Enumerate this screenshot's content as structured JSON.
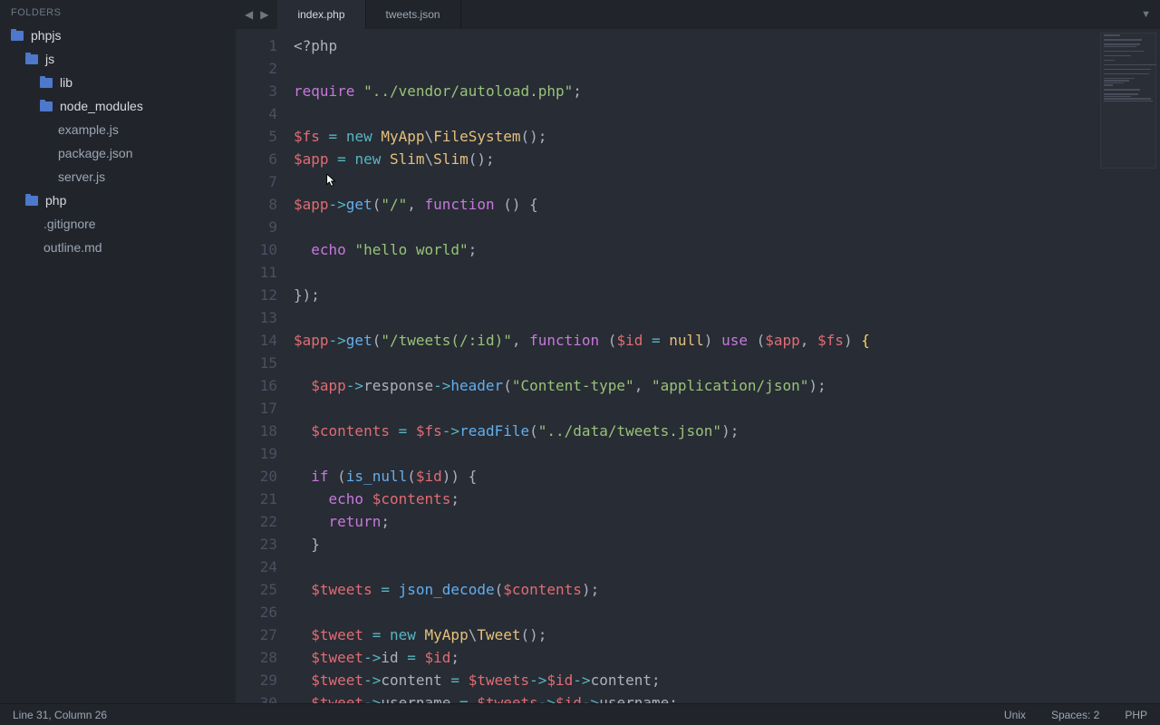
{
  "sidebar": {
    "header": "FOLDERS",
    "tree": [
      {
        "type": "folder",
        "label": "phpjs",
        "depth": 0
      },
      {
        "type": "folder",
        "label": "js",
        "depth": 1
      },
      {
        "type": "folder",
        "label": "lib",
        "depth": 2
      },
      {
        "type": "folder",
        "label": "node_modules",
        "depth": 2
      },
      {
        "type": "file",
        "label": "example.js",
        "depth": 2
      },
      {
        "type": "file",
        "label": "package.json",
        "depth": 2
      },
      {
        "type": "file",
        "label": "server.js",
        "depth": 2
      },
      {
        "type": "folder",
        "label": "php",
        "depth": 1
      },
      {
        "type": "file",
        "label": ".gitignore",
        "depth": 1
      },
      {
        "type": "file",
        "label": "outline.md",
        "depth": 1
      }
    ]
  },
  "tabs": [
    {
      "label": "index.php",
      "active": true
    },
    {
      "label": "tweets.json",
      "active": false
    }
  ],
  "code_lines": [
    [
      {
        "t": "<?php",
        "c": "pn"
      }
    ],
    [],
    [
      {
        "t": "require",
        "c": "kw"
      },
      {
        "t": " ",
        "c": "pn"
      },
      {
        "t": "\"../vendor/autoload.php\"",
        "c": "str"
      },
      {
        "t": ";",
        "c": "pn"
      }
    ],
    [],
    [
      {
        "t": "$fs",
        "c": "var"
      },
      {
        "t": " ",
        "c": "pn"
      },
      {
        "t": "=",
        "c": "op"
      },
      {
        "t": " ",
        "c": "pn"
      },
      {
        "t": "new",
        "c": "op"
      },
      {
        "t": " ",
        "c": "pn"
      },
      {
        "t": "MyApp",
        "c": "cls"
      },
      {
        "t": "\\",
        "c": "pn"
      },
      {
        "t": "FileSystem",
        "c": "cls"
      },
      {
        "t": "();",
        "c": "pn"
      }
    ],
    [
      {
        "t": "$app",
        "c": "var"
      },
      {
        "t": " ",
        "c": "pn"
      },
      {
        "t": "=",
        "c": "op"
      },
      {
        "t": " ",
        "c": "pn"
      },
      {
        "t": "new",
        "c": "op"
      },
      {
        "t": " ",
        "c": "pn"
      },
      {
        "t": "Slim",
        "c": "cls"
      },
      {
        "t": "\\",
        "c": "pn"
      },
      {
        "t": "Slim",
        "c": "cls"
      },
      {
        "t": "();",
        "c": "pn"
      }
    ],
    [],
    [
      {
        "t": "$app",
        "c": "var"
      },
      {
        "t": "->",
        "c": "op"
      },
      {
        "t": "get",
        "c": "fn"
      },
      {
        "t": "(",
        "c": "pn"
      },
      {
        "t": "\"/\"",
        "c": "str"
      },
      {
        "t": ", ",
        "c": "pn"
      },
      {
        "t": "function",
        "c": "kw"
      },
      {
        "t": " () {",
        "c": "pn"
      }
    ],
    [],
    [
      {
        "t": "  ",
        "c": "pn"
      },
      {
        "t": "echo",
        "c": "kw"
      },
      {
        "t": " ",
        "c": "pn"
      },
      {
        "t": "\"hello world\"",
        "c": "str"
      },
      {
        "t": ";",
        "c": "pn"
      }
    ],
    [],
    [
      {
        "t": "});",
        "c": "pn"
      }
    ],
    [],
    [
      {
        "t": "$app",
        "c": "var"
      },
      {
        "t": "->",
        "c": "op"
      },
      {
        "t": "get",
        "c": "fn"
      },
      {
        "t": "(",
        "c": "pn"
      },
      {
        "t": "\"/tweets(/:id)\"",
        "c": "str"
      },
      {
        "t": ", ",
        "c": "pn"
      },
      {
        "t": "function",
        "c": "kw"
      },
      {
        "t": " (",
        "c": "pn"
      },
      {
        "t": "$id",
        "c": "var"
      },
      {
        "t": " ",
        "c": "pn"
      },
      {
        "t": "=",
        "c": "op"
      },
      {
        "t": " ",
        "c": "pn"
      },
      {
        "t": "null",
        "c": "cls"
      },
      {
        "t": ") ",
        "c": "pn"
      },
      {
        "t": "use",
        "c": "kw"
      },
      {
        "t": " (",
        "c": "pn"
      },
      {
        "t": "$app",
        "c": "var"
      },
      {
        "t": ", ",
        "c": "pn"
      },
      {
        "t": "$fs",
        "c": "var"
      },
      {
        "t": ") ",
        "c": "pn"
      },
      {
        "t": "{",
        "c": "br"
      }
    ],
    [],
    [
      {
        "t": "  ",
        "c": "pn"
      },
      {
        "t": "$app",
        "c": "var"
      },
      {
        "t": "->",
        "c": "op"
      },
      {
        "t": "response",
        "c": "prop"
      },
      {
        "t": "->",
        "c": "op"
      },
      {
        "t": "header",
        "c": "fn"
      },
      {
        "t": "(",
        "c": "pn"
      },
      {
        "t": "\"Content-type\"",
        "c": "str"
      },
      {
        "t": ", ",
        "c": "pn"
      },
      {
        "t": "\"application/json\"",
        "c": "str"
      },
      {
        "t": ");",
        "c": "pn"
      }
    ],
    [],
    [
      {
        "t": "  ",
        "c": "pn"
      },
      {
        "t": "$contents",
        "c": "var"
      },
      {
        "t": " ",
        "c": "pn"
      },
      {
        "t": "=",
        "c": "op"
      },
      {
        "t": " ",
        "c": "pn"
      },
      {
        "t": "$fs",
        "c": "var"
      },
      {
        "t": "->",
        "c": "op"
      },
      {
        "t": "readFile",
        "c": "fn"
      },
      {
        "t": "(",
        "c": "pn"
      },
      {
        "t": "\"../data/tweets.json\"",
        "c": "str"
      },
      {
        "t": ");",
        "c": "pn"
      }
    ],
    [],
    [
      {
        "t": "  ",
        "c": "pn"
      },
      {
        "t": "if",
        "c": "kw"
      },
      {
        "t": " (",
        "c": "pn"
      },
      {
        "t": "is_null",
        "c": "fn"
      },
      {
        "t": "(",
        "c": "pn"
      },
      {
        "t": "$id",
        "c": "var"
      },
      {
        "t": ")) {",
        "c": "pn"
      }
    ],
    [
      {
        "t": "    ",
        "c": "pn"
      },
      {
        "t": "echo",
        "c": "kw"
      },
      {
        "t": " ",
        "c": "pn"
      },
      {
        "t": "$contents",
        "c": "var"
      },
      {
        "t": ";",
        "c": "pn"
      }
    ],
    [
      {
        "t": "    ",
        "c": "pn"
      },
      {
        "t": "return",
        "c": "kw"
      },
      {
        "t": ";",
        "c": "pn"
      }
    ],
    [
      {
        "t": "  }",
        "c": "pn"
      }
    ],
    [],
    [
      {
        "t": "  ",
        "c": "pn"
      },
      {
        "t": "$tweets",
        "c": "var"
      },
      {
        "t": " ",
        "c": "pn"
      },
      {
        "t": "=",
        "c": "op"
      },
      {
        "t": " ",
        "c": "pn"
      },
      {
        "t": "json_decode",
        "c": "fn"
      },
      {
        "t": "(",
        "c": "pn"
      },
      {
        "t": "$contents",
        "c": "var"
      },
      {
        "t": ");",
        "c": "pn"
      }
    ],
    [],
    [
      {
        "t": "  ",
        "c": "pn"
      },
      {
        "t": "$tweet",
        "c": "var"
      },
      {
        "t": " ",
        "c": "pn"
      },
      {
        "t": "=",
        "c": "op"
      },
      {
        "t": " ",
        "c": "pn"
      },
      {
        "t": "new",
        "c": "op"
      },
      {
        "t": " ",
        "c": "pn"
      },
      {
        "t": "MyApp",
        "c": "cls"
      },
      {
        "t": "\\",
        "c": "pn"
      },
      {
        "t": "Tweet",
        "c": "cls"
      },
      {
        "t": "();",
        "c": "pn"
      }
    ],
    [
      {
        "t": "  ",
        "c": "pn"
      },
      {
        "t": "$tweet",
        "c": "var"
      },
      {
        "t": "->",
        "c": "op"
      },
      {
        "t": "id",
        "c": "prop"
      },
      {
        "t": " ",
        "c": "pn"
      },
      {
        "t": "=",
        "c": "op"
      },
      {
        "t": " ",
        "c": "pn"
      },
      {
        "t": "$id",
        "c": "var"
      },
      {
        "t": ";",
        "c": "pn"
      }
    ],
    [
      {
        "t": "  ",
        "c": "pn"
      },
      {
        "t": "$tweet",
        "c": "var"
      },
      {
        "t": "->",
        "c": "op"
      },
      {
        "t": "content",
        "c": "prop"
      },
      {
        "t": " ",
        "c": "pn"
      },
      {
        "t": "=",
        "c": "op"
      },
      {
        "t": " ",
        "c": "pn"
      },
      {
        "t": "$tweets",
        "c": "var"
      },
      {
        "t": "->",
        "c": "op"
      },
      {
        "t": "$id",
        "c": "var"
      },
      {
        "t": "->",
        "c": "op"
      },
      {
        "t": "content",
        "c": "prop"
      },
      {
        "t": ";",
        "c": "pn"
      }
    ],
    [
      {
        "t": "  ",
        "c": "pn"
      },
      {
        "t": "$tweet",
        "c": "var"
      },
      {
        "t": "->",
        "c": "op"
      },
      {
        "t": "username",
        "c": "prop"
      },
      {
        "t": " ",
        "c": "pn"
      },
      {
        "t": "=",
        "c": "op"
      },
      {
        "t": " ",
        "c": "pn"
      },
      {
        "t": "$tweets",
        "c": "var"
      },
      {
        "t": "->",
        "c": "op"
      },
      {
        "t": "$id",
        "c": "var"
      },
      {
        "t": "->",
        "c": "op"
      },
      {
        "t": "username",
        "c": "prop"
      },
      {
        "t": ";",
        "c": "pn"
      }
    ]
  ],
  "status": {
    "position": "Line 31, Column 26",
    "encoding": "Unix",
    "indent": "Spaces: 2",
    "lang": "PHP"
  }
}
